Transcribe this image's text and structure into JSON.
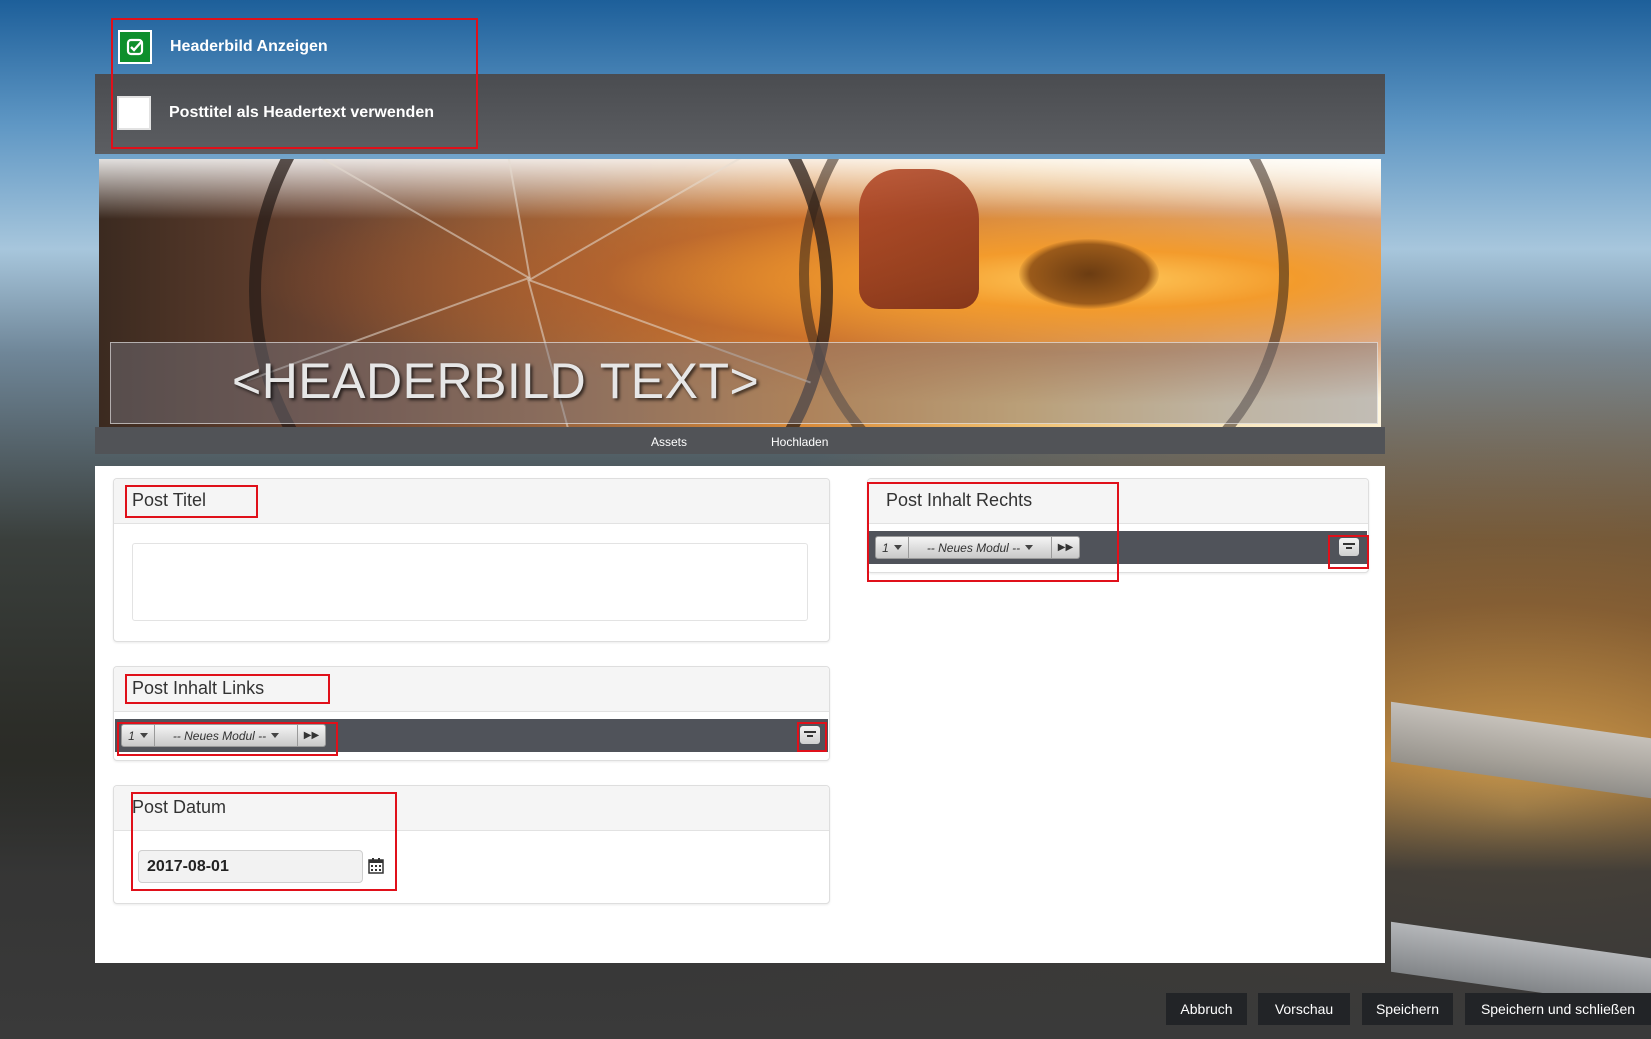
{
  "options": {
    "show_header_image": {
      "label": "Headerbild Anzeigen",
      "checked": true
    },
    "use_post_title": {
      "label": "Posttitel als Headertext verwenden",
      "checked": false
    }
  },
  "header": {
    "image_text": "<HEADERBILD TEXT>",
    "assets_label": "Assets",
    "upload_label": "Hochladen"
  },
  "cards": {
    "post_title": {
      "title": "Post Titel",
      "value": ""
    },
    "content_left": {
      "title": "Post Inhalt Links",
      "module_num": "1",
      "module_select": "-- Neues Modul --"
    },
    "date": {
      "title": "Post Datum",
      "value": "2017-08-01"
    },
    "content_right": {
      "title": "Post Inhalt Rechts",
      "module_num": "1",
      "module_select": "-- Neues Modul --"
    }
  },
  "footer": {
    "cancel": "Abbruch",
    "preview": "Vorschau",
    "save": "Speichern",
    "save_close": "Speichern und schließen"
  },
  "colors": {
    "checkbox_on": "#0e8f2c",
    "highlight": "#e0101a",
    "toolbar": "#50535a"
  },
  "icons": [
    "check-icon",
    "calendar-icon",
    "filter-icon",
    "fast-forward-icon",
    "caret-down-icon"
  ]
}
